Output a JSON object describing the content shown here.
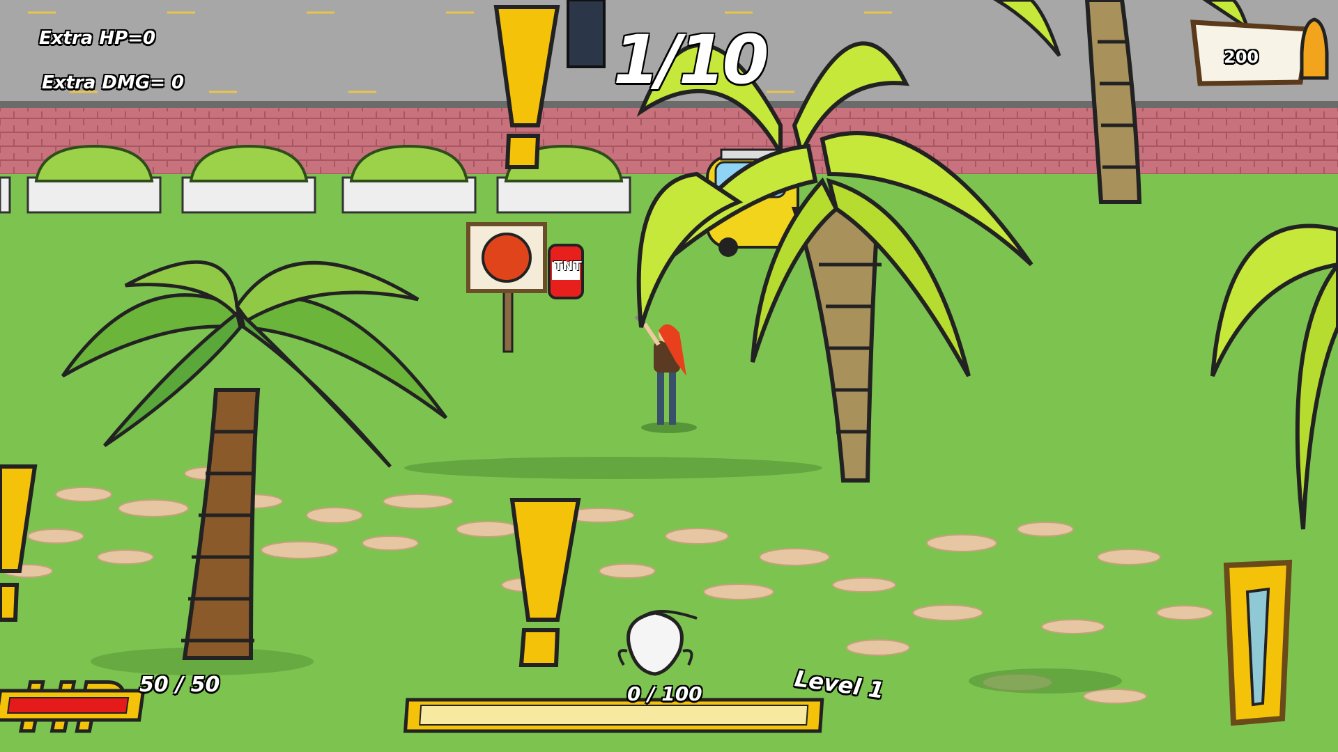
{
  "hud": {
    "extra_hp_label": "Extra HP=0",
    "extra_dmg_label": "Extra DMG= 0",
    "wave_counter": "1/10",
    "coin_count": "200",
    "hp_label": "HP",
    "hp_value": "50 / 50",
    "hp_fraction": 1.0,
    "xp_value": "0 / 100",
    "xp_fraction": 0.0,
    "level_label": "Level 1"
  },
  "world": {
    "tnt_label": "TNT"
  },
  "colors": {
    "grass": "#7cc44f",
    "road": "#a7a7a7",
    "sidewalk": "#c7727c",
    "path": "#e6c6a3",
    "palm_leaf": "#c6e83a",
    "palm_leaf_dark": "#5aa83a",
    "trunk": "#a9915c",
    "hp_red": "#e51b1b",
    "hud_yellow": "#f3c91c"
  }
}
